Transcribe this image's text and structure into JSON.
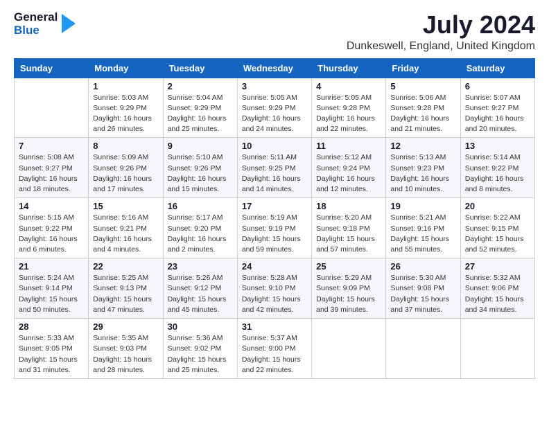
{
  "header": {
    "logo_general": "General",
    "logo_blue": "Blue",
    "month_year": "July 2024",
    "location": "Dunkeswell, England, United Kingdom"
  },
  "days_of_week": [
    "Sunday",
    "Monday",
    "Tuesday",
    "Wednesday",
    "Thursday",
    "Friday",
    "Saturday"
  ],
  "weeks": [
    [
      {
        "day": "",
        "info": ""
      },
      {
        "day": "1",
        "info": "Sunrise: 5:03 AM\nSunset: 9:29 PM\nDaylight: 16 hours\nand 26 minutes."
      },
      {
        "day": "2",
        "info": "Sunrise: 5:04 AM\nSunset: 9:29 PM\nDaylight: 16 hours\nand 25 minutes."
      },
      {
        "day": "3",
        "info": "Sunrise: 5:05 AM\nSunset: 9:29 PM\nDaylight: 16 hours\nand 24 minutes."
      },
      {
        "day": "4",
        "info": "Sunrise: 5:05 AM\nSunset: 9:28 PM\nDaylight: 16 hours\nand 22 minutes."
      },
      {
        "day": "5",
        "info": "Sunrise: 5:06 AM\nSunset: 9:28 PM\nDaylight: 16 hours\nand 21 minutes."
      },
      {
        "day": "6",
        "info": "Sunrise: 5:07 AM\nSunset: 9:27 PM\nDaylight: 16 hours\nand 20 minutes."
      }
    ],
    [
      {
        "day": "7",
        "info": "Sunrise: 5:08 AM\nSunset: 9:27 PM\nDaylight: 16 hours\nand 18 minutes."
      },
      {
        "day": "8",
        "info": "Sunrise: 5:09 AM\nSunset: 9:26 PM\nDaylight: 16 hours\nand 17 minutes."
      },
      {
        "day": "9",
        "info": "Sunrise: 5:10 AM\nSunset: 9:26 PM\nDaylight: 16 hours\nand 15 minutes."
      },
      {
        "day": "10",
        "info": "Sunrise: 5:11 AM\nSunset: 9:25 PM\nDaylight: 16 hours\nand 14 minutes."
      },
      {
        "day": "11",
        "info": "Sunrise: 5:12 AM\nSunset: 9:24 PM\nDaylight: 16 hours\nand 12 minutes."
      },
      {
        "day": "12",
        "info": "Sunrise: 5:13 AM\nSunset: 9:23 PM\nDaylight: 16 hours\nand 10 minutes."
      },
      {
        "day": "13",
        "info": "Sunrise: 5:14 AM\nSunset: 9:22 PM\nDaylight: 16 hours\nand 8 minutes."
      }
    ],
    [
      {
        "day": "14",
        "info": "Sunrise: 5:15 AM\nSunset: 9:22 PM\nDaylight: 16 hours\nand 6 minutes."
      },
      {
        "day": "15",
        "info": "Sunrise: 5:16 AM\nSunset: 9:21 PM\nDaylight: 16 hours\nand 4 minutes."
      },
      {
        "day": "16",
        "info": "Sunrise: 5:17 AM\nSunset: 9:20 PM\nDaylight: 16 hours\nand 2 minutes."
      },
      {
        "day": "17",
        "info": "Sunrise: 5:19 AM\nSunset: 9:19 PM\nDaylight: 15 hours\nand 59 minutes."
      },
      {
        "day": "18",
        "info": "Sunrise: 5:20 AM\nSunset: 9:18 PM\nDaylight: 15 hours\nand 57 minutes."
      },
      {
        "day": "19",
        "info": "Sunrise: 5:21 AM\nSunset: 9:16 PM\nDaylight: 15 hours\nand 55 minutes."
      },
      {
        "day": "20",
        "info": "Sunrise: 5:22 AM\nSunset: 9:15 PM\nDaylight: 15 hours\nand 52 minutes."
      }
    ],
    [
      {
        "day": "21",
        "info": "Sunrise: 5:24 AM\nSunset: 9:14 PM\nDaylight: 15 hours\nand 50 minutes."
      },
      {
        "day": "22",
        "info": "Sunrise: 5:25 AM\nSunset: 9:13 PM\nDaylight: 15 hours\nand 47 minutes."
      },
      {
        "day": "23",
        "info": "Sunrise: 5:26 AM\nSunset: 9:12 PM\nDaylight: 15 hours\nand 45 minutes."
      },
      {
        "day": "24",
        "info": "Sunrise: 5:28 AM\nSunset: 9:10 PM\nDaylight: 15 hours\nand 42 minutes."
      },
      {
        "day": "25",
        "info": "Sunrise: 5:29 AM\nSunset: 9:09 PM\nDaylight: 15 hours\nand 39 minutes."
      },
      {
        "day": "26",
        "info": "Sunrise: 5:30 AM\nSunset: 9:08 PM\nDaylight: 15 hours\nand 37 minutes."
      },
      {
        "day": "27",
        "info": "Sunrise: 5:32 AM\nSunset: 9:06 PM\nDaylight: 15 hours\nand 34 minutes."
      }
    ],
    [
      {
        "day": "28",
        "info": "Sunrise: 5:33 AM\nSunset: 9:05 PM\nDaylight: 15 hours\nand 31 minutes."
      },
      {
        "day": "29",
        "info": "Sunrise: 5:35 AM\nSunset: 9:03 PM\nDaylight: 15 hours\nand 28 minutes."
      },
      {
        "day": "30",
        "info": "Sunrise: 5:36 AM\nSunset: 9:02 PM\nDaylight: 15 hours\nand 25 minutes."
      },
      {
        "day": "31",
        "info": "Sunrise: 5:37 AM\nSunset: 9:00 PM\nDaylight: 15 hours\nand 22 minutes."
      },
      {
        "day": "",
        "info": ""
      },
      {
        "day": "",
        "info": ""
      },
      {
        "day": "",
        "info": ""
      }
    ]
  ]
}
